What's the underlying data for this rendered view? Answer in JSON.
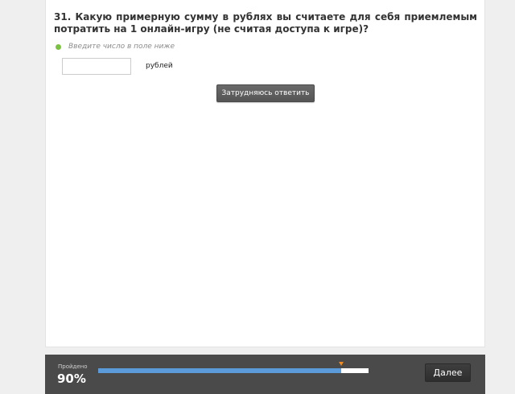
{
  "question": {
    "text": "31. Какую примерную сумму в рублях вы считаете для себя приемлемым потратить на 1 онлайн-игру (не считая доступа к игре)?"
  },
  "hint": {
    "text": "Введите число в поле ниже",
    "dot_color": "#7cc242"
  },
  "answer": {
    "value": "",
    "unit": "рублей"
  },
  "skip_button": {
    "label": "Затрудняюсь ответить"
  },
  "footer": {
    "progress_caption": "Пройдено",
    "progress_value": "90%",
    "progress_fraction": 0.9,
    "progress_fill_color": "#5b9bd9",
    "progress_marker_color": "#f08c1e",
    "next_label": "Далее"
  }
}
